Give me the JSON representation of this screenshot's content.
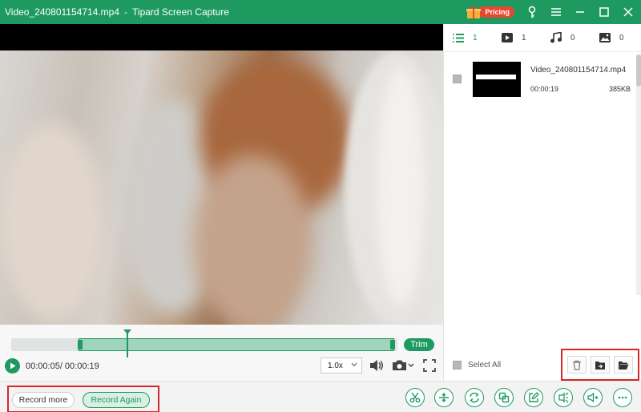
{
  "window": {
    "filename": "Video_240801154714.mp4",
    "separator": "-",
    "app_name": "Tipard Screen Capture",
    "pricing_label": "Pricing",
    "accent_color": "#1e9a61",
    "pricing_color": "#e8472f"
  },
  "player": {
    "time_display": "00:00:05/ 00:00:19",
    "trim_label": "Trim",
    "speed_value": "1.0x"
  },
  "media_tabs": [
    {
      "icon": "list-icon",
      "count": "1"
    },
    {
      "icon": "video-icon",
      "count": "1"
    },
    {
      "icon": "music-icon",
      "count": "0"
    },
    {
      "icon": "image-icon",
      "count": "0"
    }
  ],
  "files": [
    {
      "name": "Video_240801154714.mp4",
      "duration": "00:00:19",
      "size": "385KB"
    }
  ],
  "select_all_label": "Select All",
  "bottom": {
    "record_more_label": "Record more",
    "record_again_label": "Record Again",
    "tools": [
      "scissors-icon",
      "split-icon",
      "convert-icon",
      "merge-icon",
      "edit-icon",
      "compress-icon",
      "volume-boost-icon",
      "more-icon"
    ]
  }
}
